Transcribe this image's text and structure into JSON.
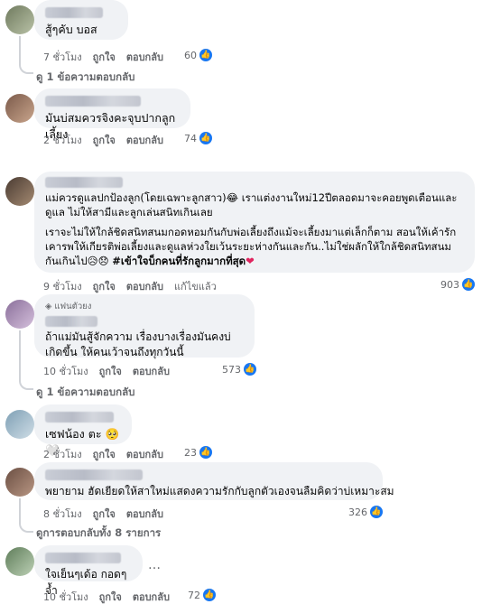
{
  "comments": [
    {
      "text": "สู้ๆคับ บอส",
      "time": "7 ชั่วโมง",
      "like_label": "ถูกใจ",
      "reply_label": "ตอบกลับ",
      "reactions": "60",
      "avatar_colors": [
        "#6f7a5e",
        "#b9c2a7"
      ],
      "more_replies": "ดู 1 ข้อความตอบกลับ"
    },
    {
      "text": "มันบ่สมควรจิงคะจุบปากลูกเลี้ยง",
      "time": "2 ชั่วโมง",
      "like_label": "ถูกใจ",
      "reply_label": "ตอบกลับ",
      "reactions": "74",
      "avatar_colors": [
        "#7b5a4a",
        "#c9a58c"
      ]
    },
    {
      "text_p1": "แม่ควรดูแลปกป้องลูก(โดยเฉพาะลูกสาว)😂 เราแต่งงานใหม่12ปีตลอดมาจะคอยพูดเตือนและดูแล ไม่ให้สามีและลูกเล่นสนิทเกินเลย",
      "text_p2": "เราจะไม่ให้ใกล้ชิดสนิทสนมกอดหอมกันกับพ่อเลี้ยงถึงแม้จะเลี้ยงมาแต่เล็กก็ตาม สอนให้เค้ารักเคารพให้เกียรติพ่อเลี้ยงและดูแลห่วงใยเว้นระยะห่างกันและกัน..ไม่ใช่ผลักให้ใกล้ชิดสนิทสนมกันเกินไป😥😞 ",
      "hashtag": "#เข้าใจบ็กคนที่รักลูกมากที่สุด",
      "time": "9 ชั่วโมง",
      "like_label": "ถูกใจ",
      "reply_label": "ตอบกลับ",
      "edited_label": "แก้ไขแล้ว",
      "reactions": "903",
      "avatar_colors": [
        "#4a3b32",
        "#a48a72"
      ]
    },
    {
      "badge": "แฟนตัวยง",
      "text": "ถ้าแม่มันสู้จักความ เรื่องบางเรื่องมันคงบ่เกิดขึ้น ให้คนเว้าจนถึงทุกวันนี้",
      "time": "10 ชั่วโมง",
      "like_label": "ถูกใจ",
      "reply_label": "ตอบกลับ",
      "reactions": "573",
      "avatar_colors": [
        "#8a6f9a",
        "#d5c0dc"
      ],
      "more_replies": "ดู 1 ข้อความตอบกลับ"
    },
    {
      "text": "เซฟน้อง ตะ 🥺🤍",
      "time": "2 ชั่วโมง",
      "like_label": "ถูกใจ",
      "reply_label": "ตอบกลับ",
      "reactions": "23",
      "avatar_colors": [
        "#7fa0b5",
        "#cfdde6"
      ]
    },
    {
      "text": "พยายาม ฮัดเยียดให้สาใหม่แสดงความรักกับลูกตัวเองจนลืมคิดว่าบ่เหมาะสม",
      "time": "8 ชั่วโมง",
      "like_label": "ถูกใจ",
      "reply_label": "ตอบกลับ",
      "reactions": "326",
      "avatar_colors": [
        "#6b4f43",
        "#b89683"
      ],
      "more_replies": "ดูการตอบกลับทั้ง 8 รายการ"
    },
    {
      "text": "ใจเย็นๆเด้อ กอดๆจ้ำ",
      "time": "10 ชั่วโมง",
      "like_label": "ถูกใจ",
      "reply_label": "ตอบกลับ",
      "reactions": "72",
      "avatar_colors": [
        "#5f7d5a",
        "#bcd0b5"
      ]
    }
  ],
  "colors": {
    "like_blue": "#1877f2",
    "bubble": "#f0f2f5",
    "meta": "#65676b"
  },
  "icons": {
    "like": "thumbs-up-icon",
    "diamond": "diamond-icon",
    "reply_arrow": "reply-arrow-icon"
  }
}
